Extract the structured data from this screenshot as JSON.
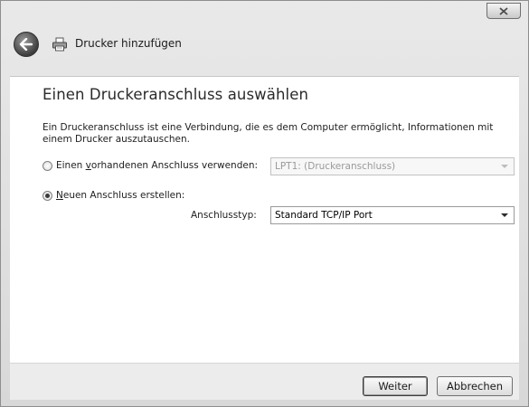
{
  "window": {
    "title": "Drucker hinzufügen"
  },
  "content": {
    "heading": "Einen Druckeranschluss auswählen",
    "description": "Ein Druckeranschluss ist eine Verbindung, die es dem Computer ermöglicht, Informationen mit einem Drucker auszutauschen.",
    "existing_port": {
      "label_pre": "Einen ",
      "label_underlined": "v",
      "label_post": "orhandenen Anschluss verwenden:",
      "selected": false,
      "dropdown_value": "LPT1: (Druckeranschluss)"
    },
    "new_port": {
      "label_underlined": "N",
      "label_post": "euen Anschluss erstellen:",
      "selected": true
    },
    "port_type": {
      "label": "Anschlusstyp:",
      "dropdown_value": "Standard TCP/IP Port"
    }
  },
  "footer": {
    "next_label": "Weiter",
    "cancel_label": "Abbrechen"
  }
}
